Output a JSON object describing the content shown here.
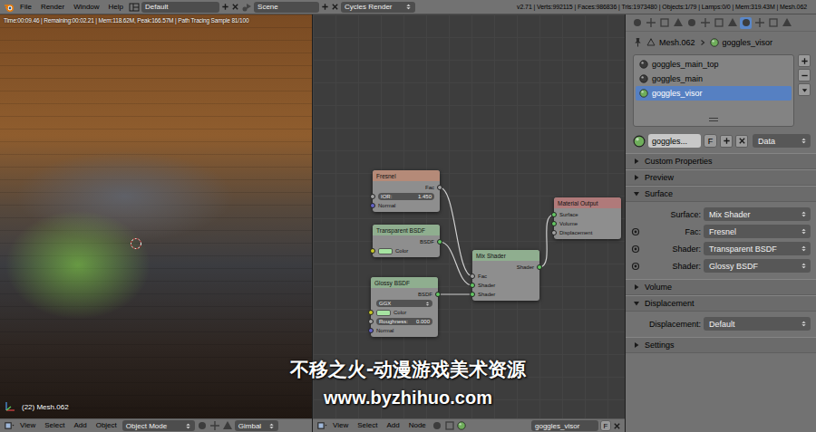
{
  "top_bar": {
    "menus": [
      "File",
      "Render",
      "Window",
      "Help"
    ],
    "layout": "Default",
    "scene": "Scene",
    "engine": "Cycles Render",
    "stats": "v2.71 | Verts:992115 | Faces:986836 | Tris:1973480 | Objects:1/79 | Lamps:0/0 | Mem:319.43M | Mesh.062"
  },
  "viewport": {
    "render_info": "Time:00:09.46 | Remaining:00:02.21 | Mem:118.62M, Peak:166.57M | Path Tracing Sample 81/100",
    "object_label": "(22) Mesh.062",
    "header": {
      "menus": [
        "View",
        "Select",
        "Add",
        "Object"
      ],
      "mode": "Object Mode",
      "orientation": "Gimbal"
    }
  },
  "node_editor": {
    "nodes": [
      {
        "title": "Fresnel",
        "color": "#b58a78",
        "rows": [
          {
            "kind": "output",
            "label": "Fac",
            "socket": "#a1a1a1"
          },
          {
            "kind": "field",
            "label": "IOR:",
            "value": "1.450",
            "socket": "#a1a1a1"
          },
          {
            "kind": "input",
            "label": "Normal",
            "socket": "#6363c7"
          }
        ]
      },
      {
        "title": "Transparent BSDF",
        "color": "#8fae8f",
        "rows": [
          {
            "kind": "output",
            "label": "BSDF",
            "socket": "#63c763"
          },
          {
            "kind": "color",
            "label": "Color",
            "socket": "#c7c729",
            "color": "#a6e3a1"
          }
        ]
      },
      {
        "title": "Glossy BSDF",
        "color": "#8fae8f",
        "rows": [
          {
            "kind": "output",
            "label": "BSDF",
            "socket": "#63c763"
          },
          {
            "kind": "dropdown",
            "label": "GGX"
          },
          {
            "kind": "color",
            "label": "Color",
            "socket": "#c7c729",
            "color": "#a6e3a1"
          },
          {
            "kind": "field",
            "label": "Roughness:",
            "value": "0.000",
            "socket": "#a1a1a1"
          },
          {
            "kind": "input",
            "label": "Normal",
            "socket": "#6363c7"
          }
        ]
      },
      {
        "title": "Mix Shader",
        "color": "#8fae8f",
        "rows": [
          {
            "kind": "output",
            "label": "Shader",
            "socket": "#63c763"
          },
          {
            "kind": "input",
            "label": "Fac",
            "socket": "#a1a1a1"
          },
          {
            "kind": "input",
            "label": "Shader",
            "socket": "#63c763"
          },
          {
            "kind": "input",
            "label": "Shader",
            "socket": "#63c763"
          }
        ]
      },
      {
        "title": "Material Output",
        "color": "#b07a7a",
        "rows": [
          {
            "kind": "input",
            "label": "Surface",
            "socket": "#63c763"
          },
          {
            "kind": "input",
            "label": "Volume",
            "socket": "#63c763"
          },
          {
            "kind": "input",
            "label": "Displacement",
            "socket": "#a1a1a1"
          }
        ]
      }
    ],
    "links": [
      {
        "from": "Fresnel",
        "to": "Mix Shader",
        "to_row": 1
      },
      {
        "from": "Transparent BSDF",
        "to": "Mix Shader",
        "to_row": 2
      },
      {
        "from": "Glossy BSDF",
        "to": "Mix Shader",
        "to_row": 3
      },
      {
        "from": "Mix Shader",
        "to": "Material Output",
        "to_row": 0
      }
    ],
    "header": {
      "menus": [
        "View",
        "Select",
        "Add",
        "Node"
      ],
      "material": "goggles_visor",
      "fake_user": "F"
    }
  },
  "properties": {
    "tabs": [
      {
        "selected": false
      },
      {
        "selected": false
      },
      {
        "selected": false
      },
      {
        "selected": false
      },
      {
        "selected": false
      },
      {
        "selected": false
      },
      {
        "selected": false
      },
      {
        "selected": false
      },
      {
        "selected": true
      },
      {
        "selected": false
      },
      {
        "selected": false
      },
      {
        "selected": false
      }
    ],
    "breadcrumb": [
      "Mesh.062",
      "goggles_visor"
    ],
    "material_slots": [
      {
        "name": "goggles_main_top",
        "selected": false,
        "color": "#3a3a3a"
      },
      {
        "name": "goggles_main",
        "selected": false,
        "color": "#3a3a3a"
      },
      {
        "name": "goggles_visor",
        "selected": true,
        "color": "#6fae5b"
      }
    ],
    "material_field": "goggles...",
    "fake_user": "F",
    "link": "Data",
    "panels": [
      {
        "title": "Custom Properties",
        "expanded": false,
        "rows": []
      },
      {
        "title": "Preview",
        "expanded": false,
        "rows": []
      },
      {
        "title": "Surface",
        "expanded": true,
        "rows": [
          {
            "label": "Surface:",
            "value": "Mix Shader",
            "linked": false
          },
          {
            "label": "Fac:",
            "value": "Fresnel",
            "linked": true
          },
          {
            "label": "Shader:",
            "value": "Transparent BSDF",
            "linked": true
          },
          {
            "label": "Shader:",
            "value": "Glossy BSDF",
            "linked": true
          }
        ]
      },
      {
        "title": "Volume",
        "expanded": false,
        "rows": []
      },
      {
        "title": "Displacement",
        "expanded": true,
        "rows": [
          {
            "label": "Displacement:",
            "value": "Default",
            "linked": false
          }
        ]
      },
      {
        "title": "Settings",
        "expanded": false,
        "rows": []
      }
    ]
  },
  "watermark": {
    "title": "不移之火-动漫游戏美术资源",
    "url": "www.byzhihuo.com"
  }
}
